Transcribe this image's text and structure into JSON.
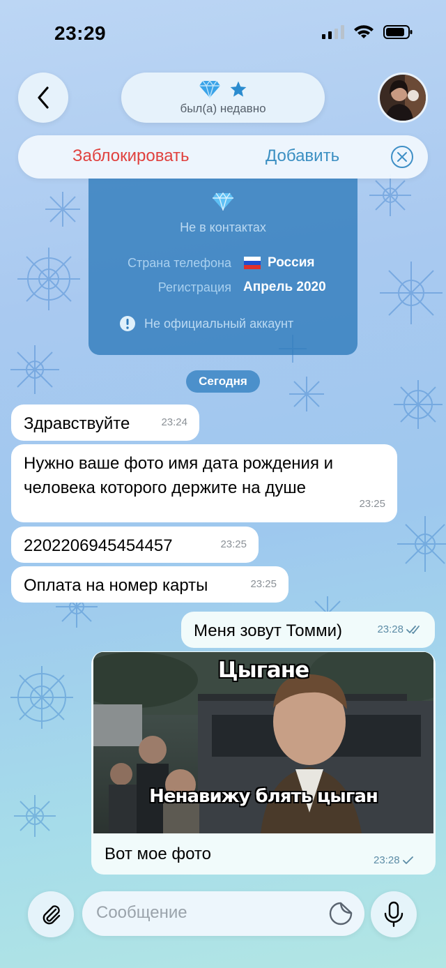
{
  "status_bar": {
    "time": "23:29"
  },
  "header": {
    "subtitle": "был(а) недавно",
    "back_icon": "chevron-left-icon",
    "badges": [
      "diamond-icon",
      "star-icon"
    ]
  },
  "action_bar": {
    "block_label": "Заблокировать",
    "add_label": "Добавить"
  },
  "info_card": {
    "not_in_contacts": "Не в контактах",
    "phone_country_label": "Страна телефона",
    "phone_country_flag": "🇷🇺",
    "phone_country_value": "Россия",
    "registration_label": "Регистрация",
    "registration_value": "Апрель 2020",
    "unofficial_notice": "Не официальный аккаунт"
  },
  "date_separator": "Сегодня",
  "messages": [
    {
      "direction": "in",
      "text": "Здравствуйте",
      "time": "23:24"
    },
    {
      "direction": "in",
      "text": "Нужно ваше фото имя дата рождения и человека которого держите на душе",
      "time": "23:25"
    },
    {
      "direction": "in",
      "text": "2202206945454457",
      "time": "23:25"
    },
    {
      "direction": "in",
      "text": "Оплата на номер карты",
      "time": "23:25"
    },
    {
      "direction": "out",
      "text": "Меня зовут Томми)",
      "time": "23:28",
      "status": "read"
    },
    {
      "direction": "out",
      "type": "photo",
      "image_top_caption": "Цыгане",
      "image_bottom_caption": "Ненавижу блять цыган",
      "text": "Вот мое фото",
      "time": "23:28",
      "status": "sent"
    }
  ],
  "composer": {
    "placeholder": "Сообщение"
  },
  "colors": {
    "block": "#e0413e",
    "add": "#3b8fc2",
    "accent": "#2d7aba"
  }
}
